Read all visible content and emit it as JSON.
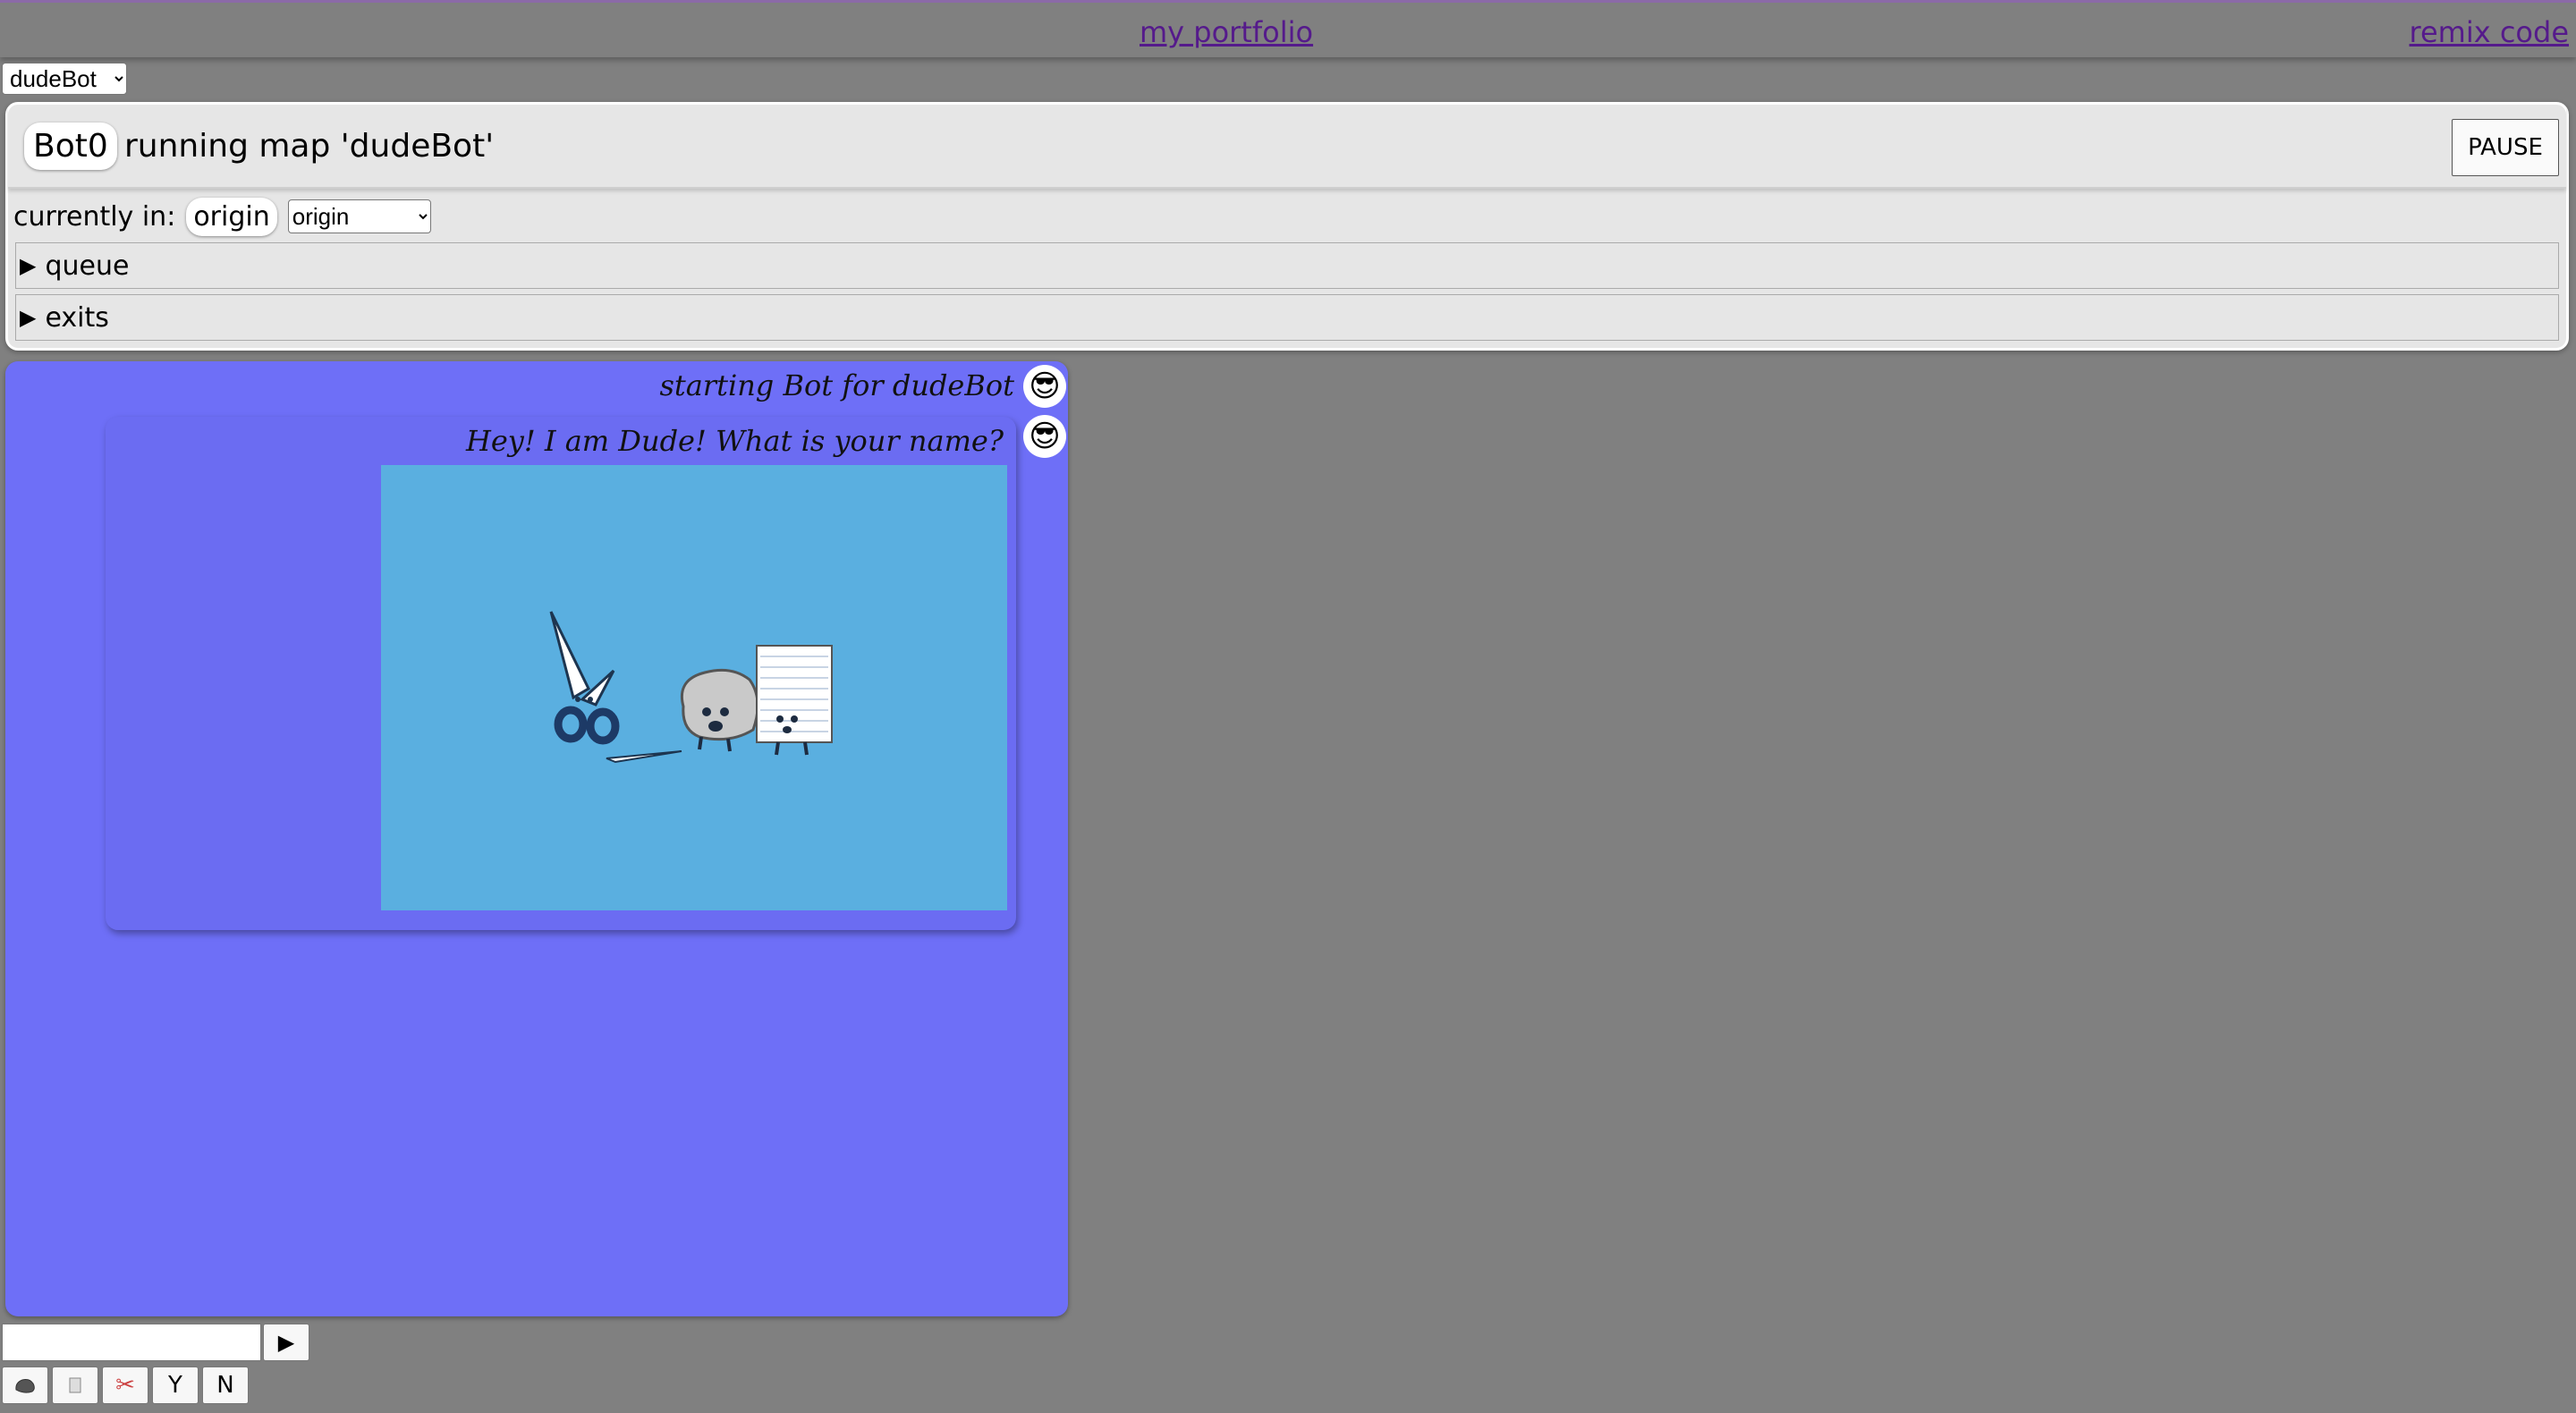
{
  "nav": {
    "portfolio_link": "my portfolio",
    "remix_link": "remix code"
  },
  "map_selector": {
    "selected": "dudeBot"
  },
  "bot": {
    "name": "Bot0",
    "status": "running map 'dudeBot'",
    "pause_label": "PAUSE",
    "currently_in_label": "currently in:",
    "current_location": "origin",
    "location_select": "origin",
    "queue_label": "queue",
    "exits_label": "exits"
  },
  "chat": {
    "messages": [
      {
        "text": "starting Bot for dudeBot",
        "avatar": "😎"
      },
      {
        "text": "Hey! I am Dude! What is your name?",
        "avatar": "😎"
      }
    ],
    "image_description_icon": "rock-paper-scissors-illustration"
  },
  "input": {
    "value": "",
    "send_symbol": "▶",
    "quick_buttons": [
      {
        "name": "rock-icon",
        "glyph": "🪨"
      },
      {
        "name": "paper-icon",
        "glyph": "📄"
      },
      {
        "name": "scissors-icon",
        "glyph": "✂"
      },
      {
        "name": "Y",
        "glyph": "Y"
      },
      {
        "name": "N",
        "glyph": "N"
      }
    ]
  },
  "colors": {
    "background": "#808080",
    "chat_background": "#6e6ff7",
    "image_background": "#5aafe0",
    "link": "#551a8b"
  }
}
